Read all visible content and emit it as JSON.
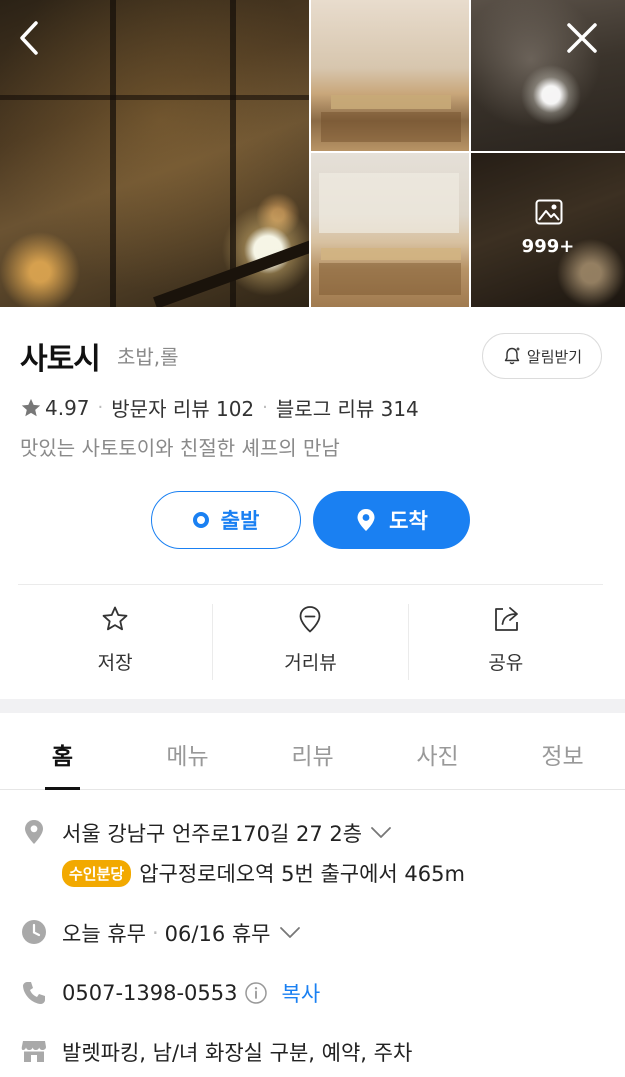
{
  "gallery": {
    "more_count": "999+"
  },
  "place": {
    "name": "사토시",
    "category": "초밥,롤",
    "alarm_label": "알림받기",
    "rating": "4.97",
    "visitor_reviews": "방문자 리뷰 102",
    "blog_reviews": "블로그 리뷰 314",
    "description": "맛있는 사토토이와 친절한 셰프의 만남"
  },
  "route": {
    "start_label": "출발",
    "arrive_label": "도착"
  },
  "actions": {
    "save": "저장",
    "street_view": "거리뷰",
    "share": "공유"
  },
  "tabs": [
    "홈",
    "메뉴",
    "리뷰",
    "사진",
    "정보"
  ],
  "info": {
    "address": "서울 강남구 언주로170길 27 2층",
    "subway_line": "수인분당",
    "subway_desc": "압구정로데오역 5번 출구에서 465m",
    "hours_today": "오늘 휴무",
    "hours_next": "06/16 휴무",
    "phone": "0507-1398-0553",
    "copy_label": "복사",
    "amenities": "발렛파킹, 남/녀 화장실 구분, 예약, 주차"
  },
  "colors": {
    "accent": "#1a80f2",
    "subway_badge": "#f2a900"
  }
}
